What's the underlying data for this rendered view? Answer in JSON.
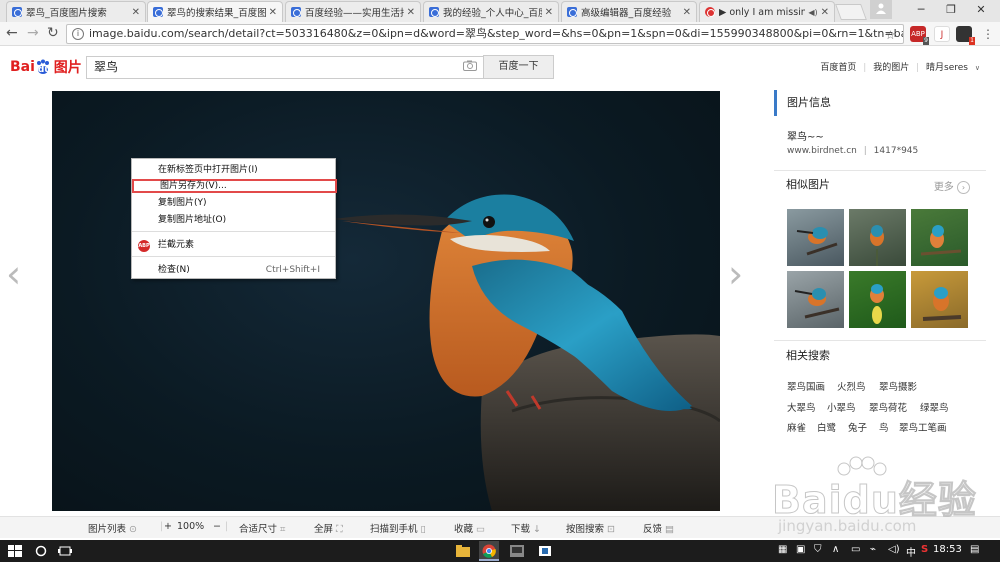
{
  "browser": {
    "tabs": [
      {
        "title": "翠鸟_百度图片搜索",
        "active": false
      },
      {
        "title": "翠鸟的搜索结果_百度图片",
        "active": true
      },
      {
        "title": "百度经验——实用生活指南",
        "active": false
      },
      {
        "title": "我的经验_个人中心_百度经验",
        "active": false
      },
      {
        "title": "高级编辑器_百度经验",
        "active": false
      },
      {
        "title": "▶ only I am missing",
        "active": false
      }
    ],
    "url": "image.baidu.com/search/detail?ct=503316480&z=0&ipn=d&word=翠鸟&step_word=&hs=0&pn=1&spn=0&di=155990348800&pi=0&rn=1&tn=baiduimagedetail",
    "ext_badge_1": "9",
    "ext_badge_2": "1"
  },
  "header": {
    "logo_text": "Bai",
    "logo_du": "du",
    "logo_suffix": "图片",
    "search_query": "翠鸟",
    "search_button": "百度一下",
    "links": [
      "百度首页",
      "我的图片",
      "晴月seres"
    ]
  },
  "context_menu": {
    "items": [
      "在新标签页中打开图片(I)",
      "图片另存为(V)...",
      "复制图片(Y)",
      "复制图片地址(O)",
      "拦截元素",
      "检查(N)"
    ],
    "inspect_shortcut": "Ctrl+Shift+I",
    "abp_label": "ABP",
    "highlighted_index": 1
  },
  "panel": {
    "info_title": "图片信息",
    "image_name": "翠鸟~~",
    "source": "www.birdnet.cn",
    "separator": "|",
    "size": "1417*945",
    "similar_title": "相似图片",
    "more_label": "更多",
    "related_title": "相关搜索",
    "related_rows": [
      [
        "翠鸟国画",
        "火烈鸟",
        "翠鸟摄影"
      ],
      [
        "大翠鸟",
        "小翠鸟",
        "翠鸟荷花",
        "绿翠鸟"
      ],
      [
        "麻雀",
        "白鹭",
        "兔子",
        "鸟",
        "翠鸟工笔画"
      ]
    ]
  },
  "bottombar": {
    "items": [
      "图片列表",
      "+",
      "100%",
      "−",
      "合适尺寸",
      "全屏",
      "扫描到手机",
      "收藏",
      "下载",
      "按图搜索",
      "反馈"
    ]
  },
  "taskbar": {
    "language": "中",
    "ime": "S",
    "clock": "18:53"
  },
  "watermark": {
    "brand": "Baidu经验",
    "url": "jingyan.baidu.com"
  },
  "colors": {
    "accent_blue": "#3a7ac8",
    "highlight_red": "#e24a4a",
    "logo_red": "#e02020",
    "logo_blue": "#2a5bd7"
  }
}
